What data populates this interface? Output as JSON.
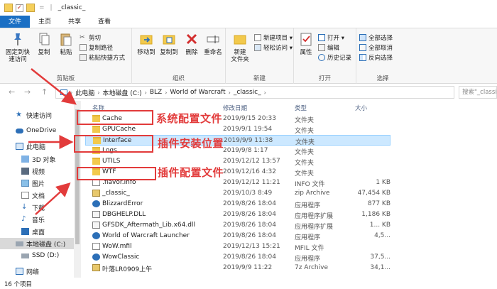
{
  "titlebar": {
    "title": "_classic_",
    "sep": "="
  },
  "tabs": [
    {
      "label": "文件"
    },
    {
      "label": "主页"
    },
    {
      "label": "共享"
    },
    {
      "label": "查看"
    }
  ],
  "ribbon": {
    "clipboard": {
      "label": "剪贴板",
      "pin": "固定到快\n速访问",
      "copy": "复制",
      "paste": "粘贴",
      "cut": "剪切",
      "copy_path": "复制路径",
      "paste_shortcut": "粘贴快捷方式"
    },
    "organize": {
      "label": "组织",
      "move_to": "移动到",
      "copy_to": "复制到",
      "delete": "删除",
      "rename": "重命名"
    },
    "new": {
      "label": "新建",
      "new_folder": "新建\n文件夹",
      "new_item": "新建项目 ▾",
      "easy_access": "轻松访问 ▾"
    },
    "open": {
      "label": "打开",
      "properties": "属性",
      "open": "打开 ▾",
      "edit": "编辑",
      "history": "历史记录"
    },
    "select": {
      "label": "选择",
      "select_all": "全部选择",
      "select_none": "全部取消",
      "invert": "反向选择"
    }
  },
  "address": {
    "crumbs": [
      "此电脑",
      "本地磁盘 (C:)",
      "BLZ",
      "World of Warcraft",
      "_classic_"
    ],
    "search_placeholder": "搜索\"_classic_\""
  },
  "sidebar": {
    "items": [
      {
        "label": "快速访问"
      },
      {
        "label": "OneDrive"
      },
      {
        "label": "此电脑"
      },
      {
        "label": "3D 对象"
      },
      {
        "label": "视频"
      },
      {
        "label": "图片"
      },
      {
        "label": "文档"
      },
      {
        "label": "下载"
      },
      {
        "label": "音乐"
      },
      {
        "label": "桌面"
      },
      {
        "label": "本地磁盘 (C:)"
      },
      {
        "label": "SSD (D:)"
      },
      {
        "label": "网络"
      }
    ]
  },
  "columns": {
    "name": "名称",
    "date": "修改日期",
    "type": "类型",
    "size": "大小"
  },
  "files": [
    {
      "name": "Cache",
      "date": "2019/9/15 20:33",
      "type": "文件夹",
      "size": "",
      "kind": "folder"
    },
    {
      "name": "GPUCache",
      "date": "2019/9/1 19:54",
      "type": "文件夹",
      "size": "",
      "kind": "folder"
    },
    {
      "name": "Interface",
      "date": "2019/9/9 11:38",
      "type": "文件夹",
      "size": "",
      "kind": "folder"
    },
    {
      "name": "Logs",
      "date": "2019/9/8 1:17",
      "type": "文件夹",
      "size": "",
      "kind": "folder"
    },
    {
      "name": "UTILS",
      "date": "2019/12/12 13:57",
      "type": "文件夹",
      "size": "",
      "kind": "folder"
    },
    {
      "name": "WTF",
      "date": "2019/12/16 4:32",
      "type": "文件夹",
      "size": "",
      "kind": "folder"
    },
    {
      "name": ".flavor.info",
      "date": "2019/12/12 11:21",
      "type": "INFO 文件",
      "size": "1 KB",
      "kind": "file"
    },
    {
      "name": "_classic_",
      "date": "2019/10/3 8:49",
      "type": "zip Archive",
      "size": "47,454 KB",
      "kind": "zip"
    },
    {
      "name": "BlizzardError",
      "date": "2019/8/26 18:04",
      "type": "应用程序",
      "size": "877 KB",
      "kind": "exe"
    },
    {
      "name": "DBGHELP.DLL",
      "date": "2019/8/26 18:04",
      "type": "应用程序扩展",
      "size": "1,186 KB",
      "kind": "dll"
    },
    {
      "name": "GFSDK_Aftermath_Lib.x64.dll",
      "date": "2019/8/26 18:04",
      "type": "应用程序扩展",
      "size": "1... KB",
      "kind": "dll"
    },
    {
      "name": "World of Warcraft Launcher",
      "date": "2019/8/26 18:04",
      "type": "应用程序",
      "size": "4,5...",
      "kind": "exe"
    },
    {
      "name": "WoW.mfil",
      "date": "2019/12/13 15:21",
      "type": "MFIL 文件",
      "size": "",
      "kind": "file"
    },
    {
      "name": "WowClassic",
      "date": "2019/8/26 18:04",
      "type": "应用程序",
      "size": "37,5...",
      "kind": "exe"
    },
    {
      "name": "叶落LR0909上午",
      "date": "2019/9/9 11:22",
      "type": "7z Archive",
      "size": "34,1...",
      "kind": "zip"
    }
  ],
  "status": {
    "count": "16 个项目"
  },
  "annotations": {
    "system_config": "系统配置文件",
    "addon_install": "插件安装位置",
    "addon_config": "插件配置文件"
  },
  "colors": {
    "accent": "#1a6fc4",
    "annotation": "#e23b3b",
    "selected_row": "#cce8ff"
  }
}
